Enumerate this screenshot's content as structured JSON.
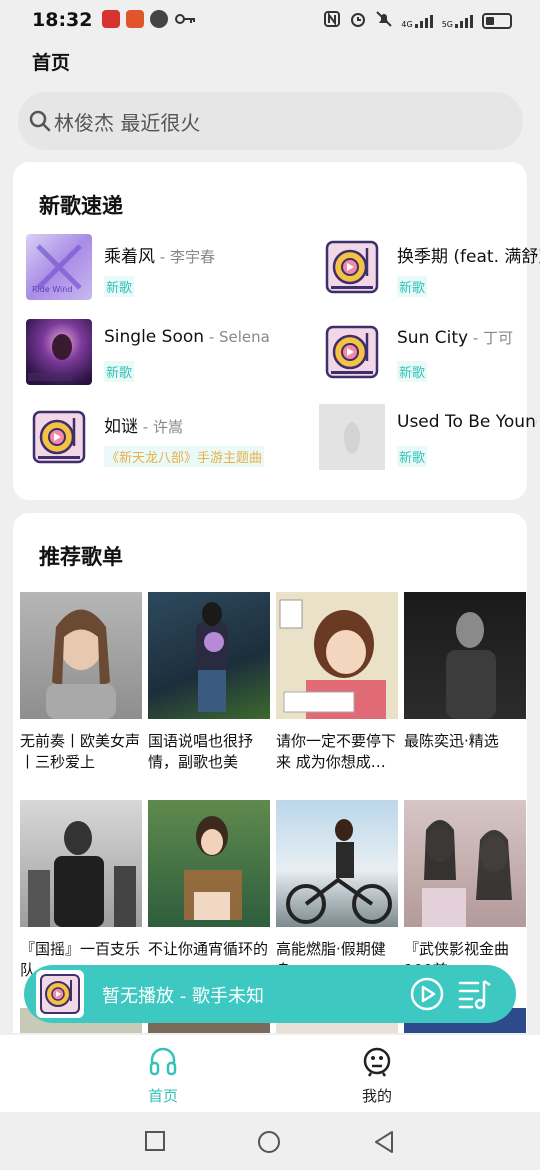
{
  "status_bar": {
    "time": "18:32",
    "signal_1": "4G",
    "signal_2": "5G"
  },
  "header": {
    "title": "首页"
  },
  "search": {
    "placeholder": "林俊杰 最近很火",
    "icon": "search-icon"
  },
  "new_songs": {
    "title": "新歌速递",
    "items": [
      {
        "name": "乘着风",
        "artist": "李宇春",
        "tag": "新歌",
        "cover": "album-art"
      },
      {
        "name": "换季期 (feat. 满舒克)",
        "artist": "",
        "tag": "新歌",
        "cover": "record-player-icon"
      },
      {
        "name": "Single Soon",
        "artist": "Selena",
        "tag": "新歌",
        "cover": "album-art"
      },
      {
        "name": "Sun City",
        "artist": "丁可",
        "tag": "新歌",
        "cover": "record-player-icon"
      },
      {
        "name": "如谜",
        "artist": "许嵩",
        "tag": "《新天龙八部》手游主题曲",
        "cover": "record-player-icon"
      },
      {
        "name": "Used To Be Young",
        "artist": "",
        "tag": "新歌",
        "cover": "album-art"
      }
    ]
  },
  "playlists": {
    "title": "推荐歌单",
    "items": [
      {
        "title": "无前奏丨欧美女声丨三秒爱上"
      },
      {
        "title": "国语说唱也很抒情，副歌也美"
      },
      {
        "title": "请你一定不要停下来 成为你想成…"
      },
      {
        "title": "最陈奕迅·精选"
      },
      {
        "title": "『国摇』一百支乐队"
      },
      {
        "title": "不让你通宵循环的"
      },
      {
        "title": "高能燃脂·假期健身"
      },
      {
        "title": "『武侠影视金曲100首』"
      }
    ]
  },
  "mini_player": {
    "text": "暂无播放 - 歌手未知"
  },
  "tabbar": {
    "home": "首页",
    "me": "我的"
  },
  "colors": {
    "accent": "#3dc8c1",
    "tag_text": "#33c3b9"
  }
}
